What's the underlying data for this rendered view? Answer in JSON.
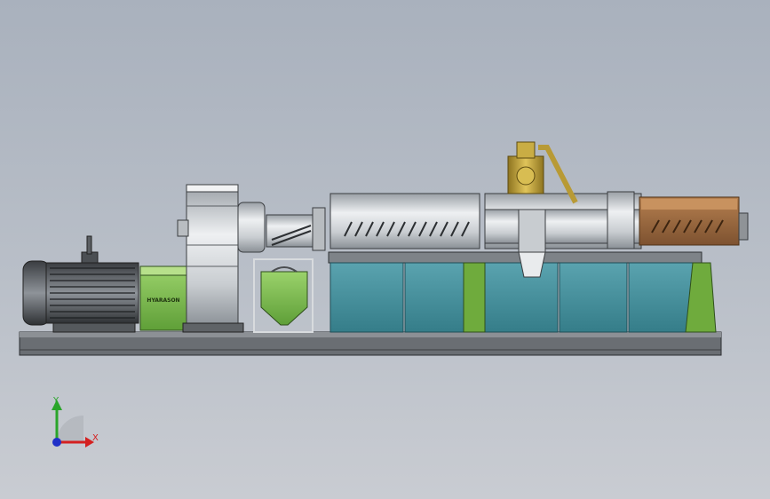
{
  "model": {
    "motor_brand": "HYARASON"
  },
  "triad": {
    "y_label": "Y",
    "x_label": "X",
    "colors": {
      "y": "#2aa52a",
      "x": "#d42020",
      "z": "#2030c8"
    }
  },
  "colors": {
    "background_top": "#a9b1bd",
    "background_bottom": "#c9ccd2",
    "frame": "#5d6166",
    "tank": "#3f8e9b",
    "green_part": "#7fc053",
    "brass": "#c4a53a",
    "copper_box": "#9a6a3f",
    "steel": "#d8dadc"
  }
}
